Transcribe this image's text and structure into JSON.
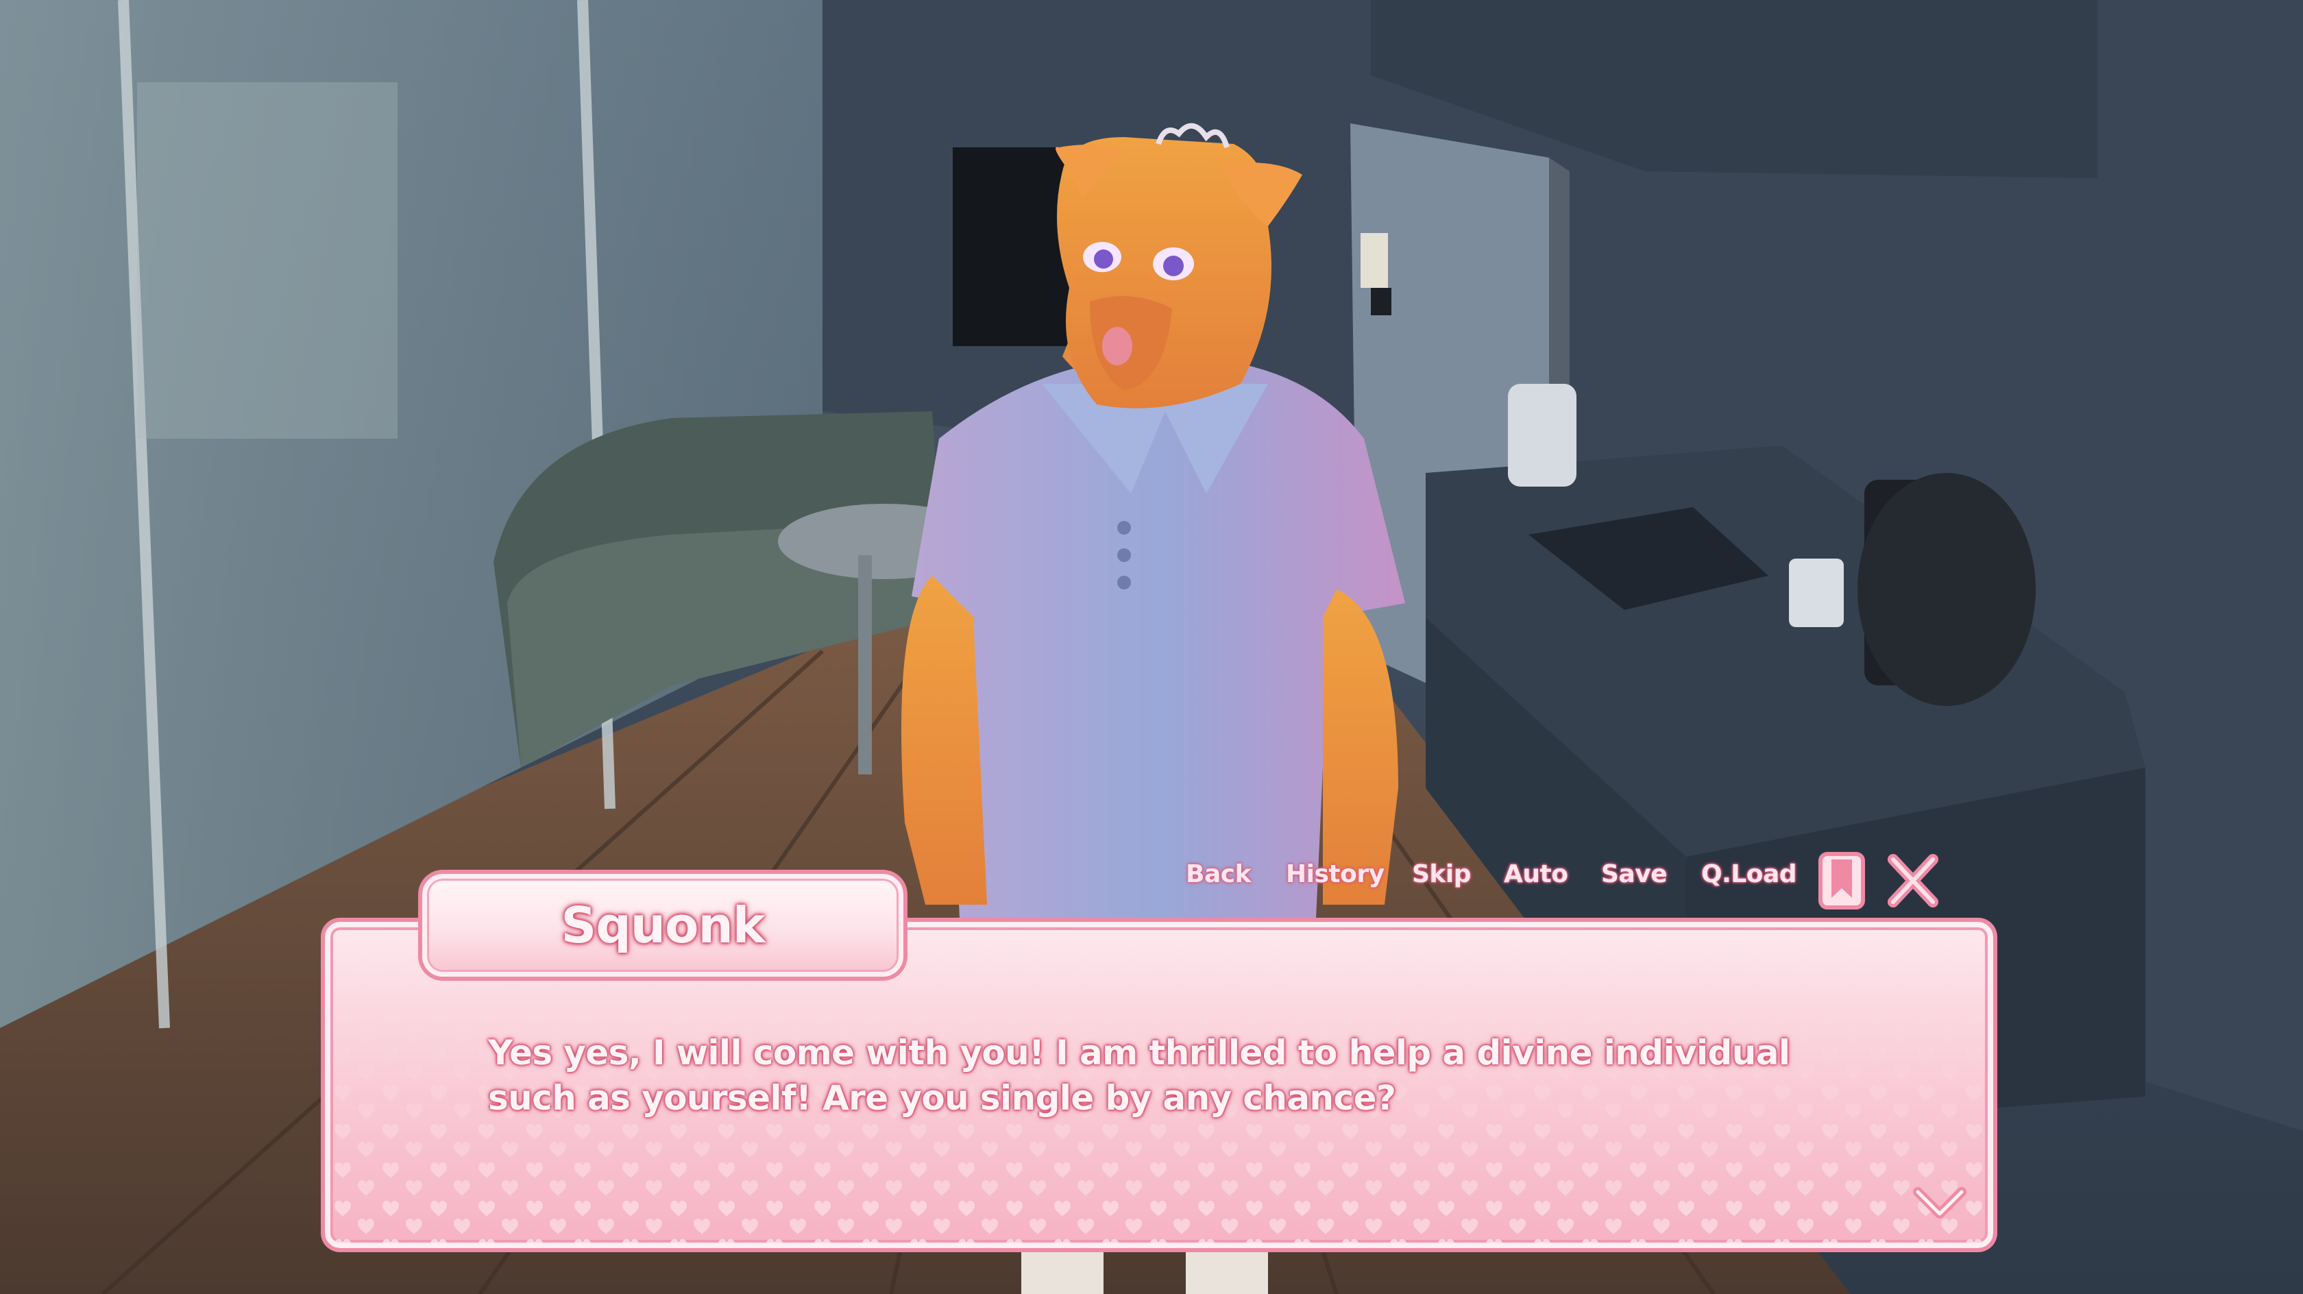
{
  "quick_menu": {
    "back": "Back",
    "history": "History",
    "skip": "Skip",
    "auto": "Auto",
    "save": "Save",
    "qload": "Q.Load",
    "bookmark_icon": "bookmark-icon",
    "close_icon": "close-x-icon"
  },
  "dialogue": {
    "speaker": "Squonk",
    "text": "Yes yes, I will come with you! I am thrilled to help a divine individual such as yourself! Are you single by any chance?"
  },
  "colors": {
    "accent_pink": "#ef8aa5",
    "text_outline": "#d8506f",
    "box_fill": "#fbd6df"
  }
}
